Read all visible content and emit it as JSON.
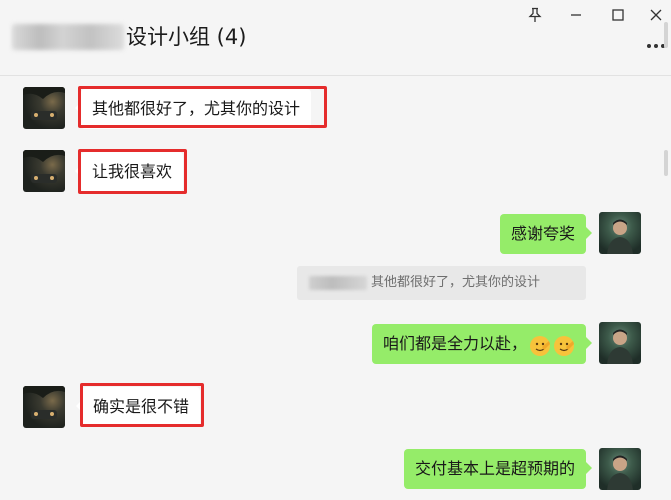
{
  "header": {
    "title_suffix": "设计小组 (4)",
    "window_controls": [
      "pin-icon",
      "minimize-icon",
      "maximize-icon",
      "close-icon"
    ],
    "more_icon": "more-icon"
  },
  "messages": [
    {
      "side": "left",
      "text": "其他都很好了，尤其你的设计",
      "highlighted": true
    },
    {
      "side": "left",
      "text": "让我很喜欢",
      "highlighted": true
    },
    {
      "side": "right",
      "text": "感谢夸奖"
    },
    {
      "type": "quote",
      "text": "其他都很好了，尤其你的设计"
    },
    {
      "side": "right",
      "text": "咱们都是全力以赴，",
      "emoji": [
        "salute-face-emoji",
        "salute-face-emoji"
      ]
    },
    {
      "side": "left",
      "text": "确实是很不错",
      "highlighted": true
    },
    {
      "side": "right",
      "text": "交付基本上是超预期的"
    }
  ],
  "colors": {
    "background": "#f5f5f5",
    "incoming_bubble": "#ffffff",
    "outgoing_bubble": "#95ec69",
    "highlight_border": "#e52c2c",
    "quote_background": "#e8e8e8"
  }
}
